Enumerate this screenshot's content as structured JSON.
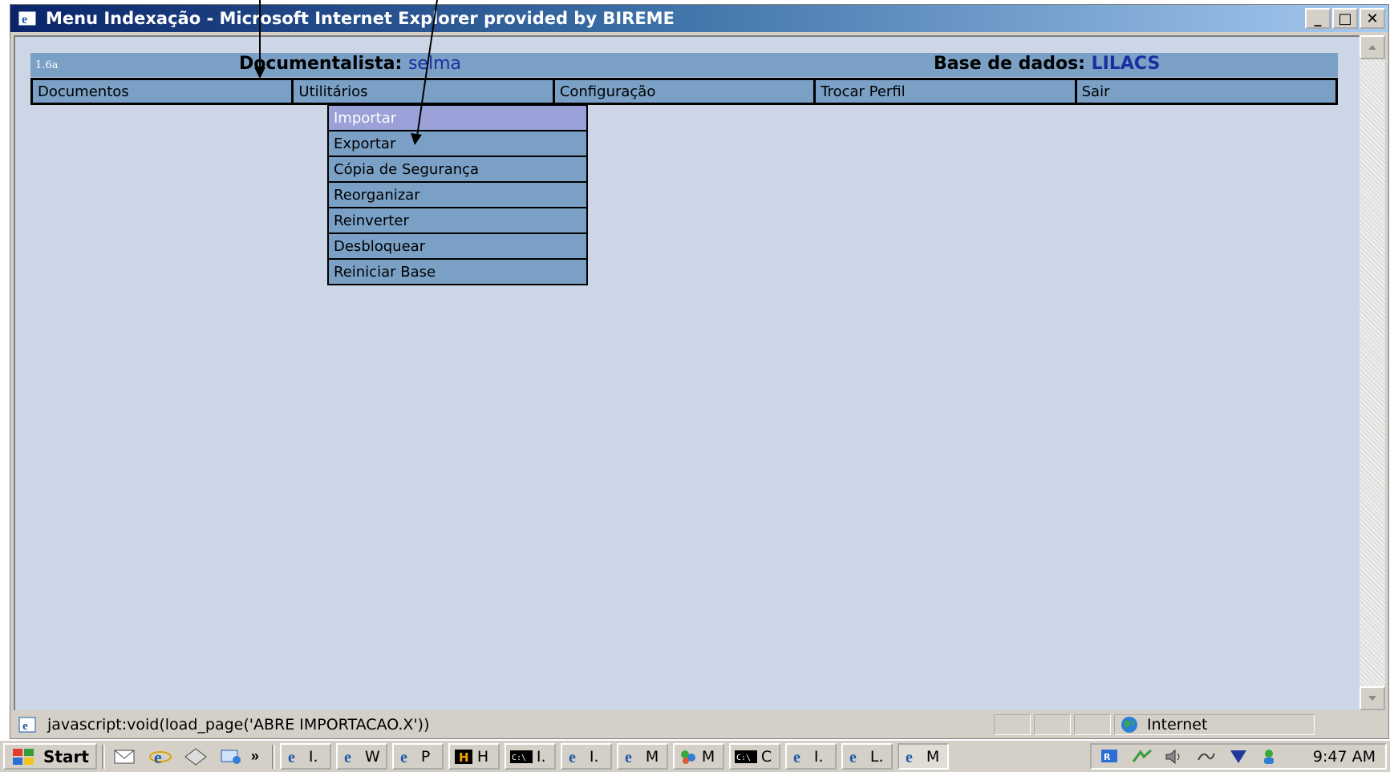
{
  "window": {
    "title": "Menu Indexação - Microsoft Internet Explorer provided by BIREME",
    "buttons": {
      "minimize": "_",
      "maximize": "□",
      "close": "✕"
    }
  },
  "header": {
    "version": "1.6a",
    "documentalista_label": "Documentalista:",
    "documentalista_value": "selma",
    "base_label": "Base de dados:",
    "base_value": "LILACS"
  },
  "menu": {
    "items": [
      {
        "label": "Documentos"
      },
      {
        "label": "Utilitários"
      },
      {
        "label": "Configuração"
      },
      {
        "label": "Trocar Perfil"
      },
      {
        "label": "Sair"
      }
    ]
  },
  "dropdown": {
    "items": [
      {
        "label": "Importar",
        "active": true
      },
      {
        "label": "Exportar"
      },
      {
        "label": "Cópia de Segurança"
      },
      {
        "label": "Reorganizar"
      },
      {
        "label": "Reinverter"
      },
      {
        "label": "Desbloquear"
      },
      {
        "label": "Reiniciar Base"
      }
    ]
  },
  "statusbar": {
    "text": "javascript:void(load_page('ABRE IMPORTACAO.X'))",
    "zone": "Internet"
  },
  "taskbar": {
    "start_label": "Start",
    "quicklaunch_more": "»",
    "tasks": [
      {
        "icon": "ie-icon",
        "label": "I."
      },
      {
        "icon": "ie-icon",
        "label": "W"
      },
      {
        "icon": "ie-icon",
        "label": "P"
      },
      {
        "icon": "app-h-icon",
        "label": "H"
      },
      {
        "icon": "cmd-icon",
        "label": "I."
      },
      {
        "icon": "ie-icon",
        "label": "I."
      },
      {
        "icon": "ie-icon",
        "label": "M"
      },
      {
        "icon": "msn-icon",
        "label": "M"
      },
      {
        "icon": "cmd-icon",
        "label": "C"
      },
      {
        "icon": "ie-icon",
        "label": "I."
      },
      {
        "icon": "ie-icon",
        "label": "L."
      },
      {
        "icon": "ie-icon",
        "label": "M",
        "active": true
      }
    ],
    "clock": "9:47 AM"
  },
  "colors": {
    "page_bg": "#cdd6e6",
    "menu_bg": "#7aa0c6",
    "active_item": "#9aa0d8",
    "value_text": "#1a2ea0"
  }
}
